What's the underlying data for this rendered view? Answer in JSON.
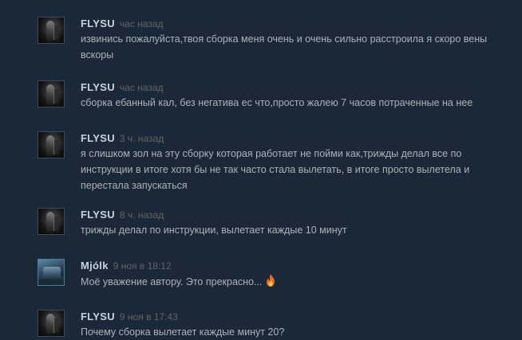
{
  "comments": [
    {
      "author": "FLYSU",
      "timestamp": "час назад",
      "text": "извинись пожалуйста,твоя сборка меня очень и очень сильно расстроила я скоро вены вскоры",
      "avatar": "dark-figure-avatar"
    },
    {
      "author": "FLYSU",
      "timestamp": "час назад",
      "text": "сборка ебанный кал, без негатива ес что,просто жалею 7 часов потраченные на нее",
      "avatar": "dark-figure-avatar"
    },
    {
      "author": "FLYSU",
      "timestamp": "3 ч. назад",
      "text": "я слишком зол на эту сборку которая работает не пойми как,трижды делал все по инструкции в итоге хотя бы не так часто стала вылетать, в итоге просто вылетела и перестала запускаться",
      "avatar": "dark-figure-avatar"
    },
    {
      "author": "FLYSU",
      "timestamp": "8 ч. назад",
      "text": "трижды делал по инструкции, вылетает каждые 10 минут",
      "avatar": "dark-figure-avatar"
    },
    {
      "author": "Mjólk",
      "timestamp": "9 ноя в 18:12",
      "text": "Моё уважение автору. Это прекрасно...",
      "emoji": "fire-emoji",
      "avatar": "blue-scene-avatar"
    },
    {
      "author": "FLYSU",
      "timestamp": "9 ноя в 17:43",
      "text": "Почему сборка вылетает каждые минут 20?",
      "avatar": "dark-figure-avatar"
    }
  ],
  "colors": {
    "background": "#1b2838",
    "author": "#c6d4df",
    "timestamp": "#626366",
    "text": "#acb2b8"
  }
}
